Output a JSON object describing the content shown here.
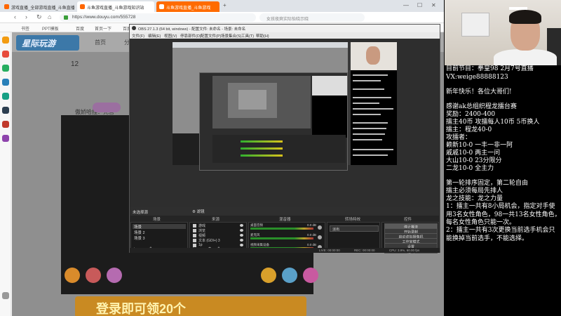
{
  "browser": {
    "tabs": [
      {
        "label": "游戏直播_全部游戏直播_斗鱼直播"
      },
      {
        "label": "斗鱼游戏直播_斗鱼游戏知识站"
      },
      {
        "label": "斗鱼游戏直播_斗鱼游戏"
      }
    ],
    "url": "https://www.douyu.com/555728",
    "search_placeholder": "女孩夜爽实际怡晓示晓",
    "bookmarks": [
      "书签",
      "PPT模板",
      "百度",
      "首页一下",
      "百度旅览"
    ],
    "page": {
      "logo_text": "星际玩游",
      "nav_home": "首页",
      "nav_classify": "分类",
      "level": "12",
      "streamer_name": "傲娇哈挂：完善",
      "promo_text": "登录即可领20个"
    }
  },
  "obs": {
    "title": "OBS 27.1.3 (64 bit, windows) - 配置文件: 未命名 - 场景: 未命名",
    "menu": [
      "文件(F)",
      "编辑(E)",
      "视图(V)",
      "停靠部件(D)",
      "配置文件(P)",
      "场景集合(S)",
      "工具(T)",
      "帮助(H)"
    ],
    "scene_bar_label": "未选择源",
    "filter_label": "滤镜",
    "headers": {
      "scenes": "场景",
      "sources": "来源",
      "mixer": "混音器",
      "transitions": "转场特效",
      "controls": "控件"
    },
    "scenes": [
      "场景",
      "场景 2",
      "场景 3"
    ],
    "sources": [
      "游戏",
      "浏览",
      "视频",
      "文本 (GDI+) 3",
      "1p"
    ],
    "mixer": [
      {
        "name": "桌面音频",
        "db": "0.0 dB"
      },
      {
        "name": "麦克风",
        "db": "0.0 dB"
      },
      {
        "name": "视频采集设备",
        "db": "0.0 dB"
      }
    ],
    "transition": "淡出",
    "controls": [
      "停止推流",
      "开始录制",
      "启动虚拟摄像机",
      "工作室模式",
      "设置",
      "退出"
    ],
    "status": {
      "live": "LIVE: 00:00:00",
      "rec": "REC: 00:00:00",
      "cpu": "CPU: 3.9%, 60.00 fps"
    }
  },
  "overlay": {
    "lines": [
      {
        "text": "目前节目：拳皇98 2月7号直播"
      },
      {
        "text": "VX:weige88888123"
      },
      {
        "text": ""
      },
      {
        "text": "新年快乐！各位大哥们!"
      },
      {
        "text": ""
      },
      {
        "text": "感谢ak总组织程龙擂台赛"
      },
      {
        "text": "奖励：2400-400"
      },
      {
        "text": "擂主40币 攻擂每人10币 5币换人"
      },
      {
        "text": "擂主：程龙40-0"
      },
      {
        "text": "攻擂者："
      },
      {
        "text": "赖新10-0 一丰一非一阿"
      },
      {
        "text": "戚戚10-0 两主一问"
      },
      {
        "text": "大山10-0 23分限分"
      },
      {
        "text": "二龙10-0 全主力"
      },
      {
        "text": ""
      },
      {
        "text": "第一轮排序固定，第二轮自由"
      },
      {
        "text": "擂主必须每局先排人"
      },
      {
        "text": "龙之技能：龙之力量"
      },
      {
        "text": "1：擂主一共有8小局机会，指定对手使用3名女性角色，98一共13名女性角色，每名女性角色只能一次。"
      },
      {
        "text": "2：擂主一共有3次更换当前选手机会只能换掉当前选手，不能选择。"
      }
    ]
  }
}
